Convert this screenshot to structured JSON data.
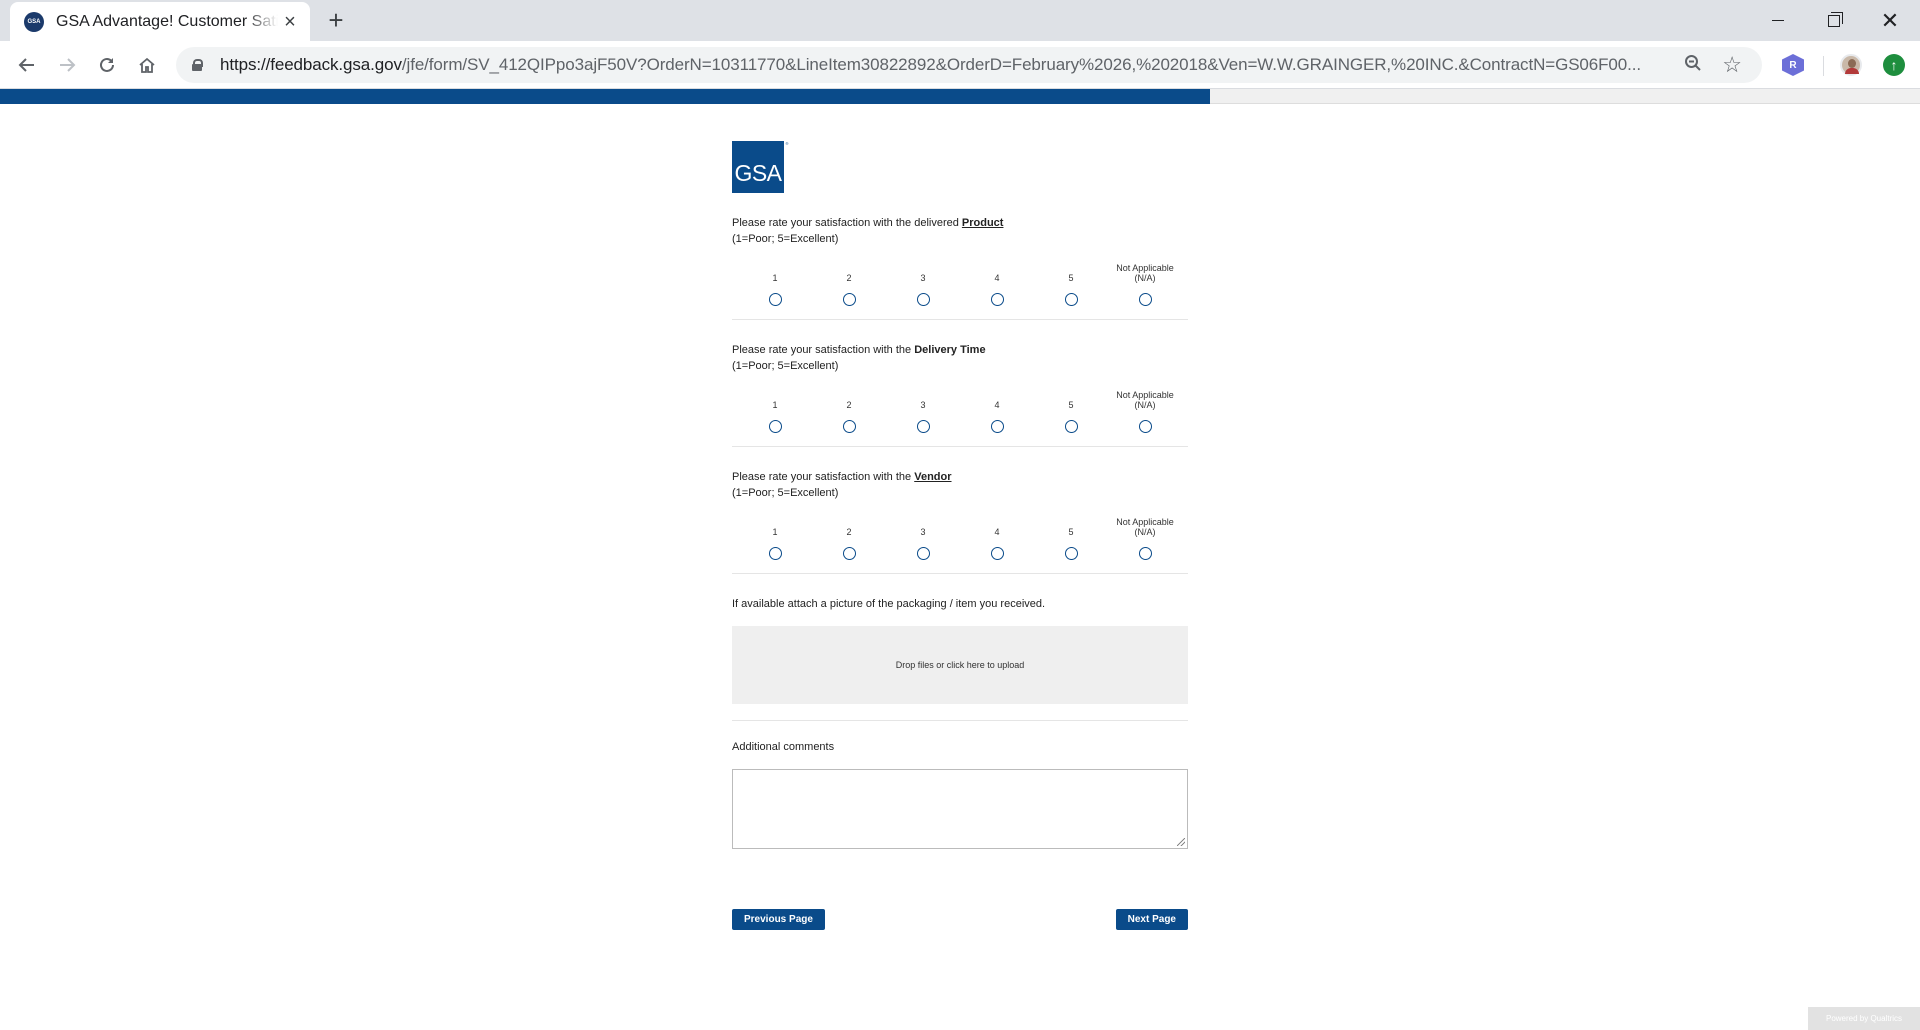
{
  "browser": {
    "tab_title": "GSA Advantage! Customer Satisfaction Survey",
    "favicon_text": "GSA",
    "new_tab_label": "+",
    "url_host": "https://feedback.gsa.gov",
    "url_rest": "/jfe/form/SV_412QIPpo3ajF50V?OrderN=10311770&LineItem30822892&OrderD=February%2026,%202018&Ven=W.W.GRAINGER,%20INC.&ContractN=GS06F00...",
    "extension_label": "R"
  },
  "progress": {
    "fraction": 0.63
  },
  "logo": {
    "text": "GSA",
    "reg": "®"
  },
  "scale_labels": [
    "1",
    "2",
    "3",
    "4",
    "5",
    "Not Applicable (N/A)"
  ],
  "questions": [
    {
      "prefix": "Please rate your satisfaction with the delivered ",
      "emphasis": "Product",
      "hint": "(1=Poor; 5=Excellent)"
    },
    {
      "prefix": "Please rate your satisfaction with the ",
      "emphasis": "Delivery Time",
      "hint": "(1=Poor; 5=Excellent)"
    },
    {
      "prefix": "Please rate your satisfaction with the ",
      "emphasis": "Vendor",
      "hint": "(1=Poor; 5=Excellent)"
    }
  ],
  "upload": {
    "label": "If available attach a picture of the packaging / item you received.",
    "dropzone_text": "Drop files or click here to upload"
  },
  "comments": {
    "label": "Additional comments",
    "value": ""
  },
  "buttons": {
    "previous": "Previous Page",
    "next": "Next Page"
  },
  "footer": {
    "powered_by": "Powered by Qualtrics"
  },
  "colors": {
    "brand": "#0a4b8a"
  }
}
